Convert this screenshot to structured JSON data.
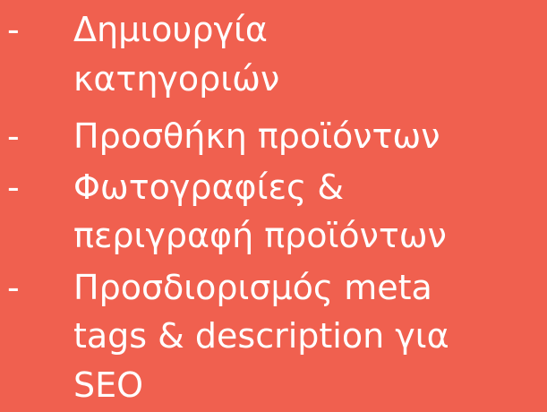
{
  "slide": {
    "background_color": "#f0604f",
    "text_color": "#ffffff",
    "bullet_marker": "-",
    "bullets": [
      {
        "lines": [
          "Δημιουργία",
          "κατηγοριών"
        ]
      },
      {
        "lines": [
          "Προσθήκη προϊόντων"
        ]
      },
      {
        "lines": [
          "Φωτογραφίες &",
          "περιγραφή προϊόντων"
        ]
      },
      {
        "lines": [
          "Προσδιορισμός meta",
          "tags & description για",
          "SEO"
        ]
      }
    ]
  }
}
